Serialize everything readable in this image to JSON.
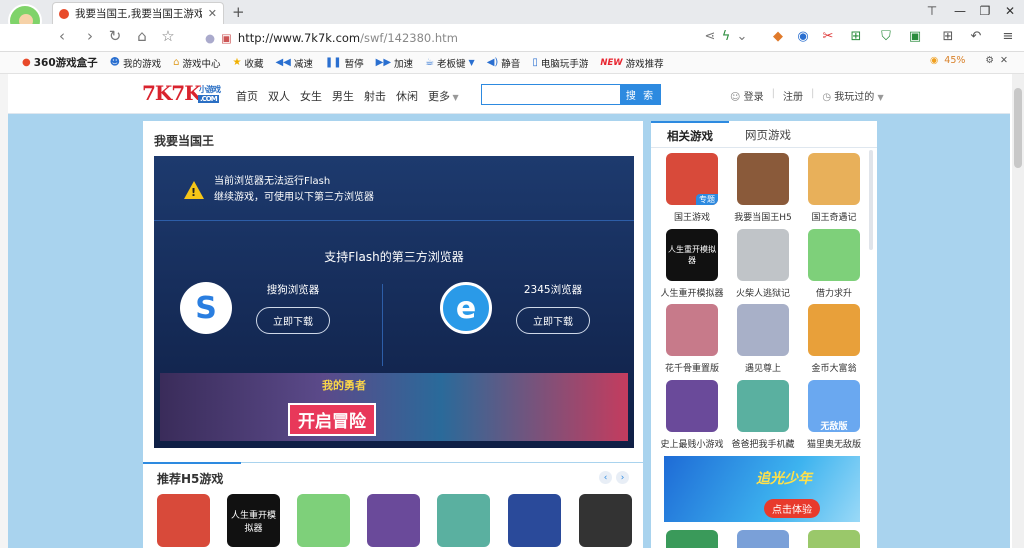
{
  "browser": {
    "tab_title": "我要当国王,我要当国王游戏在线",
    "url_host": "http://www.7k7k.com",
    "url_path": "/swf/142380.htm"
  },
  "bookmarks": [
    {
      "icon": "gamepad-icon",
      "label": "360游戏盒子"
    },
    {
      "icon": "user-icon",
      "label": "我的游戏"
    },
    {
      "icon": "home-icon",
      "label": "游戏中心"
    },
    {
      "icon": "star-icon",
      "label": "收藏"
    },
    {
      "icon": "rewind-icon",
      "label": "减速"
    },
    {
      "icon": "pause-icon",
      "label": "暂停"
    },
    {
      "icon": "forward-icon",
      "label": "加速"
    },
    {
      "icon": "keyboard-icon",
      "label": "老板键"
    },
    {
      "icon": "mute-icon",
      "label": "静音"
    },
    {
      "icon": "phone-icon",
      "label": "电脑玩手游"
    },
    {
      "icon": "new-badge-icon",
      "label": "游戏推荐"
    }
  ],
  "new_badge": "NEW",
  "battery": "45%",
  "site": {
    "logo": "7K7K",
    "logo_sub": "小游戏",
    "logo_com": ".COM",
    "nav": [
      "首页",
      "双人",
      "女生",
      "男生",
      "射击",
      "休闲",
      "更多"
    ],
    "search_button": "搜 索",
    "login": "登录",
    "register": "注册",
    "played": "我玩过的"
  },
  "game": {
    "title": "我要当国王",
    "warning_line1": "当前浏览器无法运行Flash",
    "warning_line2": "继续游戏，可使用以下第三方浏览器",
    "support_heading": "支持Flash的第三方浏览器",
    "browser1": "搜狗浏览器",
    "browser2": "2345浏览器",
    "download": "立即下载",
    "banner_text": "开启冒险",
    "banner_logo": "我的勇者"
  },
  "h5": {
    "title": "推荐H5游戏"
  },
  "right": {
    "tab_related": "相关游戏",
    "tab_web": "网页游戏",
    "tag": "专题",
    "games": [
      {
        "label": "国王游戏",
        "color": "#d84a3a"
      },
      {
        "label": "我要当国王H5",
        "color": "#8a5a3a"
      },
      {
        "label": "国王奇遇记",
        "color": "#e8b05a"
      },
      {
        "label": "人生重开模拟器",
        "color": "#111111"
      },
      {
        "label": "火柴人逃狱记",
        "color": "#c0c4c8"
      },
      {
        "label": "借力求升",
        "color": "#7ed07a"
      },
      {
        "label": "花千骨重置版",
        "color": "#c77a8a"
      },
      {
        "label": "遇见尊上",
        "color": "#a8b0c8"
      },
      {
        "label": "金币大富翁",
        "color": "#e8a03a"
      },
      {
        "label": "史上最贱小游戏",
        "color": "#6a4a9a"
      },
      {
        "label": "爸爸把我手机藏",
        "color": "#5ab0a0"
      },
      {
        "label": "猫里奥无敌版",
        "color": "#6aa8f0"
      }
    ],
    "cover_text_1": "人生重开模拟器",
    "cover_text_2": "无敌版",
    "ad_title": "追光少年",
    "ad_button": "点击体验"
  },
  "h5_games": [
    {
      "color": "#d84a3a"
    },
    {
      "color": "#111111",
      "text": "人生重开模拟器"
    },
    {
      "color": "#7ed07a"
    },
    {
      "color": "#6a4a9a"
    },
    {
      "color": "#5ab0a0"
    },
    {
      "color": "#2a4a9a"
    },
    {
      "color": "#333333"
    }
  ]
}
